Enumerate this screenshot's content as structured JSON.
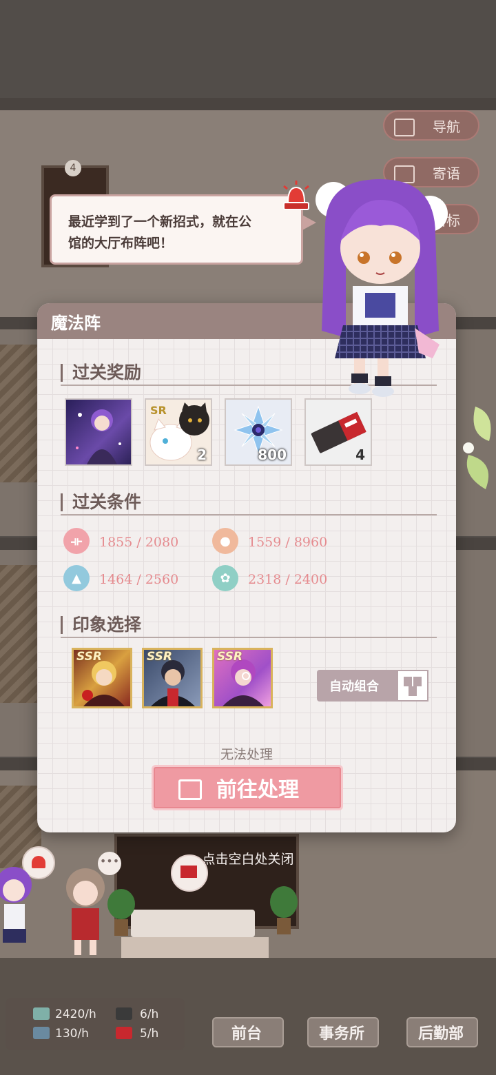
{
  "navigation": {
    "buttons": [
      {
        "label": "导航",
        "icon": "map-icon"
      },
      {
        "label": "寄语",
        "icon": "notebook-icon"
      },
      {
        "label": "目标",
        "icon": "target-icon"
      }
    ]
  },
  "floor_sign": "4",
  "speech": {
    "text_line1": "最近学到了一个新招式，就在公",
    "text_line2": "馆的大厅布阵吧！"
  },
  "modal": {
    "title": "魔法阵",
    "rewards_title": "过关奖励",
    "rewards": [
      {
        "name": "character-card-reward",
        "count": ""
      },
      {
        "name": "sr-cat-reward",
        "badge": "SR",
        "count": "2"
      },
      {
        "name": "crystal-reward",
        "count": "800"
      },
      {
        "name": "ticket-reward",
        "count": "4"
      }
    ],
    "conditions_title": "过关条件",
    "conditions": [
      {
        "icon": "dumbbell-icon",
        "color": "#f1a3aa",
        "current": "1855",
        "target": "/ 2080"
      },
      {
        "icon": "person-icon",
        "color": "#f0b99c",
        "current": "1559",
        "target": "/ 8960"
      },
      {
        "icon": "graduation-cap-icon",
        "color": "#92c9dd",
        "current": "1464",
        "target": "/ 2560"
      },
      {
        "icon": "flower-icon",
        "color": "#8fcfc5",
        "current": "2318",
        "target": "/ 2400"
      }
    ],
    "impression_title": "印象选择",
    "cards": [
      {
        "rarity": "SSR",
        "name": "blonde-character-card"
      },
      {
        "rarity": "SSR",
        "name": "dark-hair-character-card"
      },
      {
        "rarity": "SSR",
        "name": "purple-hair-character-card"
      }
    ],
    "auto_button": "自动组合",
    "status_text": "无法处理",
    "goto_button": "前往处理"
  },
  "close_hint": "点击空白处关闭",
  "bottom_bar": {
    "stats": [
      {
        "icon": "cash-icon",
        "value": "2420/h"
      },
      {
        "icon": "book-icon",
        "value": "130/h"
      },
      {
        "icon": "fan-icon",
        "value": "6/h"
      },
      {
        "icon": "gift-icon",
        "value": "5/h"
      }
    ],
    "tabs": [
      "前台",
      "事务所",
      "后勤部"
    ]
  },
  "colors": {
    "modal_header": "#9a8480",
    "primary_button": "#ef9aa2",
    "condition_text": "#e58b8f",
    "ssr_border": "#d9b35c"
  }
}
